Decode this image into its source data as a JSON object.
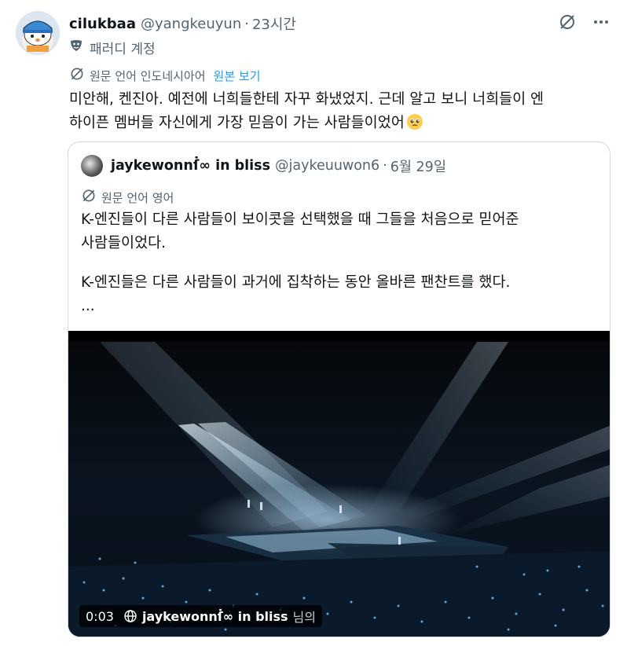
{
  "post": {
    "display_name": "cilukbaa",
    "handle": "@yangkeuyun",
    "separator": "·",
    "time": "23시간",
    "parody_label": "패러디 계정",
    "translate_label": "원문 언어 인도네시아어",
    "show_original_label": "원본 보기",
    "text_line1": "미안해, 켄진아. 예전에 너희들한테 자꾸 화냈었지. 근데 알고 보니 너희들이 엔",
    "text_line2": "하이픈 멤버들 자신에게 가장 믿음이 가는 사람들이었어"
  },
  "quote": {
    "display_name": "jaykewonnẛ∞ in bliss",
    "handle": "@jaykeuuwon6",
    "separator": "·",
    "time": "6월 29일",
    "translate_label": "원문 언어 영어",
    "line1": "K-엔진들이 다른 사람들이 보이콧을 선택했을 때 그들을 처음으로 믿어준",
    "line2": "사람들이었다.",
    "line3": "K-엔진들은 다른 사람들이 과거에 집착하는 동안 올바른 팬찬트를 했다.",
    "line4": "...",
    "video": {
      "time": "0:03",
      "source_name": "jaykewonnẛ∞ in bliss",
      "source_suffix": "님의"
    }
  },
  "icons": {
    "grok": "grok-icon",
    "more": "more-icon",
    "parody": "parody-mask-icon",
    "translate": "translate-icon",
    "emoji": "pleading-face-emoji"
  },
  "colors": {
    "text": "#0f1419",
    "secondary": "#536471",
    "link": "#1d9bf0",
    "border": "#cfd9de"
  }
}
